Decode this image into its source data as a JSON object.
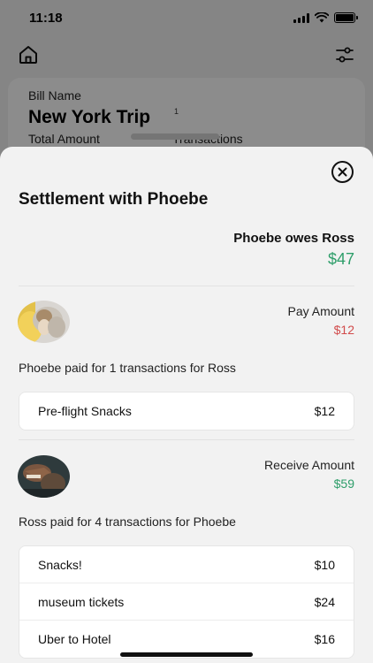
{
  "status_bar": {
    "time": "11:18"
  },
  "bill": {
    "label": "Bill Name",
    "name": "New York Trip",
    "superscript": "1",
    "total_label": "Total Amount",
    "transactions_label": "Transactions"
  },
  "sheet": {
    "title": "Settlement with Phoebe",
    "owes_text": "Phoebe owes Ross",
    "owes_amount": "$47",
    "pay": {
      "label": "Pay Amount",
      "amount": "$12",
      "paid_text": "Phoebe paid for 1 transactions for Ross",
      "transactions": [
        {
          "name": "Pre-flight Snacks",
          "amount": "$12"
        }
      ]
    },
    "receive": {
      "label": "Receive Amount",
      "amount": "$59",
      "paid_text": "Ross paid for 4 transactions for Phoebe",
      "transactions": [
        {
          "name": "Snacks!",
          "amount": "$10"
        },
        {
          "name": "museum tickets",
          "amount": "$24"
        },
        {
          "name": "Uber to Hotel",
          "amount": "$16"
        }
      ]
    }
  },
  "icons": {
    "home": "home-icon",
    "filter": "filter-settings-icon",
    "close": "close-circle-icon"
  },
  "colors": {
    "positive": "#2e9e6a",
    "negative": "#d14b4b"
  }
}
